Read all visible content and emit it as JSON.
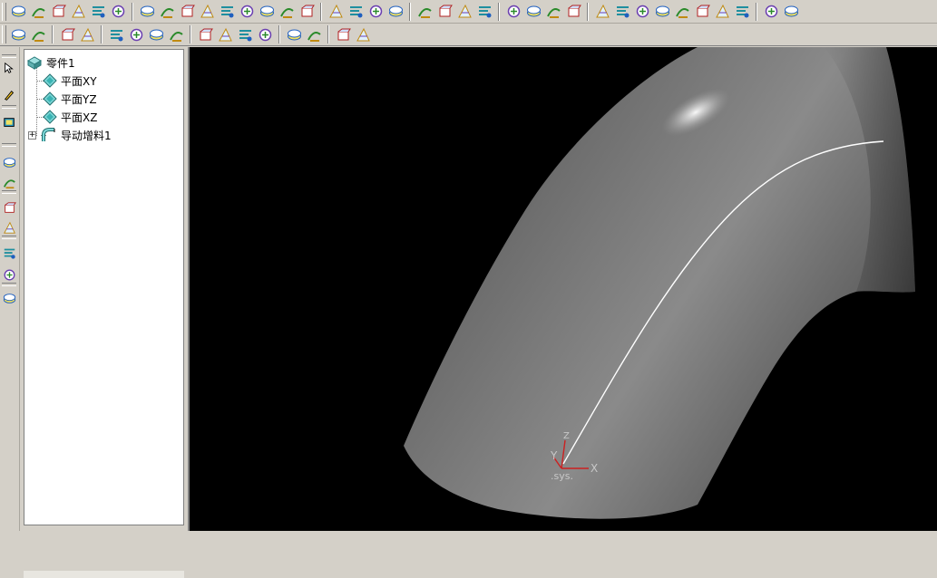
{
  "toolbar_row1": {
    "icons": [
      "extrude-icon",
      "revolve-icon",
      "sweep-icon",
      "loft-icon",
      "rib-icon",
      "hole-icon",
      "fillet-icon",
      "chamfer-icon",
      "shell-icon",
      "draft-icon",
      "pattern-icon",
      "mirror-icon",
      "thicken-icon",
      "split-icon",
      "face-offset-icon",
      "surface-extrude-icon",
      "surface-revolve-icon",
      "surface-sweep-icon",
      "surface-loft-icon",
      "curve-icon",
      "spline-icon",
      "helix-icon",
      "project-curve-icon",
      "datum-plane-icon",
      "datum-axis-icon",
      "datum-point-icon",
      "coordinate-system-icon",
      "measure-icon",
      "section-icon",
      "hatch-icon",
      "trim-icon",
      "extend-icon",
      "offset-icon",
      "intersect-icon",
      "stitch-icon",
      "analysis-icon",
      "render-icon"
    ]
  },
  "toolbar_row2": {
    "icons": [
      "sketch-line-icon",
      "sketch-arc-icon",
      "constraint-perpendicular-icon",
      "constraint-tangent-icon",
      "constraint-parallel-icon",
      "constraint-coincident-icon",
      "constraint-equal-icon",
      "constraint-fix-icon",
      "dimension-linear-icon",
      "dimension-angular-icon",
      "dimension-radial-icon",
      "dimension-diameter-icon",
      "dimension-symmetric-icon",
      "dimension-chain-icon",
      "dimension-baseline-icon",
      "dimension-ordinate-icon"
    ]
  },
  "left_toolbar": {
    "icons": [
      "select-arrow-icon",
      "pencil-icon",
      "parameters-icon",
      "sketch-constraint-icon",
      "sketch-dimension-icon",
      "sketch-trim-icon",
      "sketch-edit-icon",
      "sketch-mirror-icon",
      "sketch-offset-icon",
      "layers-icon"
    ]
  },
  "tree": {
    "root": {
      "label": "零件1",
      "icon": "part-icon"
    },
    "children": [
      {
        "label": "平面XY",
        "icon": "plane-icon"
      },
      {
        "label": "平面YZ",
        "icon": "plane-icon"
      },
      {
        "label": "平面XZ",
        "icon": "plane-icon"
      },
      {
        "label": "导动增料1",
        "icon": "sweep-feature-icon",
        "expandable": true,
        "expand_symbol": "+"
      }
    ]
  },
  "viewport": {
    "background": "#000000",
    "coordinate_system": {
      "x_label": "X",
      "y_label": "Y",
      "z_label": "Z",
      "name": ".sys."
    },
    "colors": {
      "axis": "#cc2020",
      "path_curve": "#ffffff",
      "surface": "#808080"
    }
  }
}
